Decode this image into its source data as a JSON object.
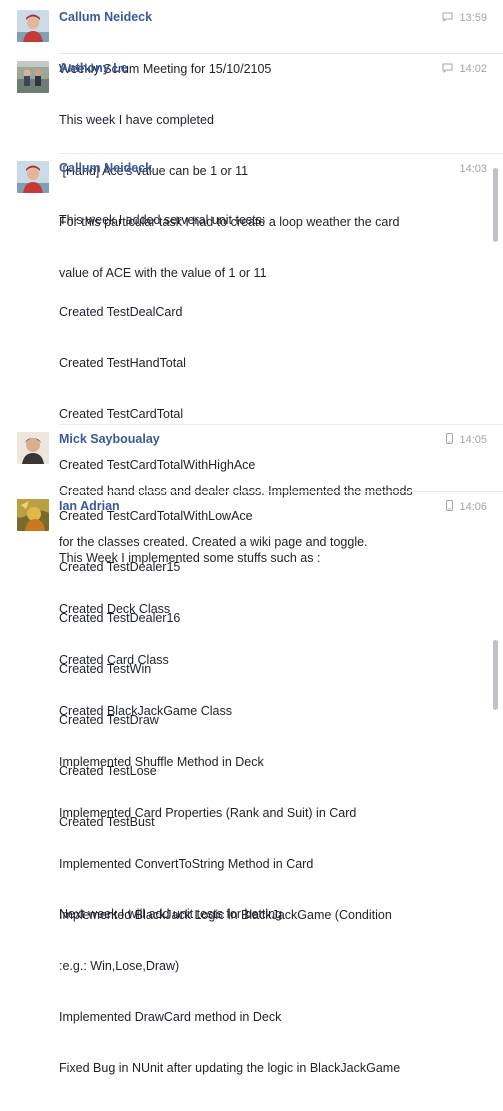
{
  "messages": [
    {
      "author": "Callum Neideck",
      "time": "13:59",
      "lines": [
        "Weekly Scrum Meeting for 15/10/2105"
      ]
    },
    {
      "author": "Anthony Le",
      "time": "14:02",
      "lines": [
        "This week I have completed",
        " [Hand] Ace's value can be 1 or 11",
        "For this particular task I had to create a loop weather the card",
        "value of ACE with the value of 1 or 11"
      ]
    },
    {
      "author": "Callum Neideck",
      "time": "14:03",
      "lines": [
        "This week I added serveral unit tests:",
        "",
        "Created TestDealCard",
        "Created TestHandTotal",
        "Created TestCardTotal",
        "Created TestCardTotalWithHighAce",
        "Created TestCardTotalWithLowAce",
        "Created TestDealer15",
        "Created TestDealer16",
        "Created TestWin",
        "Created TestDraw",
        "Created TestLose",
        "Created TestBust",
        "",
        "Next week I will add unit tests for betting"
      ]
    },
    {
      "author": "Mick Sayboualay",
      "time": "14:05",
      "lines": [
        "Created hand class and dealer class. Implemented the methods",
        "for the classes created. Created a wiki page and toggle."
      ]
    },
    {
      "author": "Ian Adrian",
      "time": "14:06",
      "lines": [
        "This Week I implemented some stuffs such as :",
        "Created Deck Class",
        "Created Card Class",
        "Created BlackJackGame Class",
        "Implemented Shuffle Method in Deck",
        "Implemented Card Properties (Rank and Suit) in Card",
        "Implemented ConvertToString Method in Card",
        "Implemented BlackJack Logic in BlackJackGame (Condition",
        ":e.g.: Win,Lose,Draw)",
        "Implemented DrawCard method in Deck",
        "Fixed Bug in NUnit after updating the logic in BlackJackGame"
      ]
    }
  ],
  "icons": [
    "chat-bubble-icon",
    "chat-bubble-icon",
    "none",
    "mobile-phone-icon",
    "mobile-phone-icon"
  ],
  "colors": {
    "author": "#3b5998",
    "text": "#1d2129",
    "timestamp": "#a0a4ad",
    "scrollbar": "#bec3c9"
  }
}
